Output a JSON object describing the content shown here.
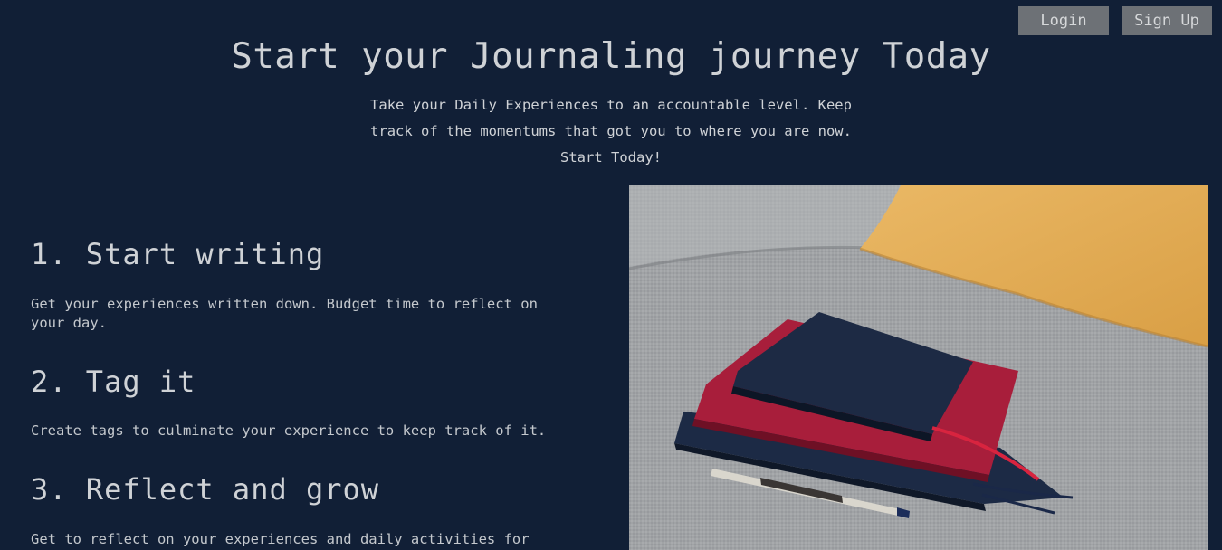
{
  "nav": {
    "login_label": "Login",
    "signup_label": "Sign Up"
  },
  "hero": {
    "title": "Start your Journaling journey Today",
    "subtitle_line1": "Take your Daily Experiences to an accountable level. Keep",
    "subtitle_line2": "track of the momentums that got you to where you are now.",
    "subtitle_line3": "Start Today!"
  },
  "steps": [
    {
      "title": "1. Start writing",
      "text_line1": "Get your experiences written down. Budget time to reflect on",
      "text_line2": "your day."
    },
    {
      "title": "2. Tag it",
      "text_line1": "Create tags to culminate your experience to keep track of it."
    },
    {
      "title": "3. Reflect and grow",
      "text_line1": "Get to reflect on your experiences and daily activities for"
    }
  ],
  "colors": {
    "background": "#111f36",
    "button": "#6d7176",
    "text": "#cfd2d6"
  },
  "image": {
    "icon": "journals-photo"
  }
}
